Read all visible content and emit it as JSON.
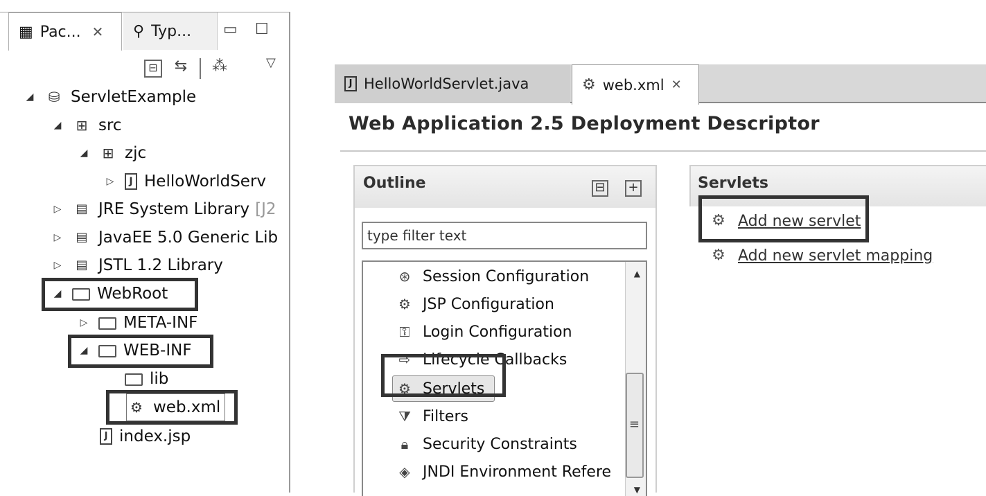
{
  "left_panel": {
    "tabs": [
      {
        "label": "Pac...",
        "close": "✕"
      },
      {
        "label": "Typ..."
      }
    ],
    "minimize": "▭",
    "maximize": "☐",
    "menu": "▽",
    "toolbar": {
      "collapse_all": "⊟",
      "link_with_editor": "⇆",
      "filters": "⁂"
    },
    "tree": {
      "project": "ServletExample",
      "src": "src",
      "package": "zjc",
      "java_file": "HelloWorldServ",
      "jre_lib": "JRE System Library",
      "jre_suffix": "[J2",
      "javaee_lib": "JavaEE 5.0 Generic Lib",
      "jstl_lib": "JSTL 1.2 Library",
      "webroot": "WebRoot",
      "meta_inf": "META-INF",
      "web_inf": "WEB-INF",
      "lib": "lib",
      "web_xml": "web.xml",
      "index_jsp": "index.jsp"
    }
  },
  "editor": {
    "tabs": [
      {
        "label": "HelloWorldServlet.java"
      },
      {
        "label": "web.xml",
        "close": "✕"
      }
    ],
    "title": "Web Application 2.5 Deployment Descriptor",
    "outline": {
      "title": "Outline",
      "collapse": "⊟",
      "expand": "+",
      "filter_placeholder": "type filter text",
      "items": [
        "Session Configuration",
        "JSP Configuration",
        "Login Configuration",
        "Lifecycle Callbacks",
        "Servlets",
        "Filters",
        "Security Constraints",
        "JNDI Environment Refere"
      ]
    },
    "servlets": {
      "title": "Servlets",
      "add_servlet": "Add new servlet",
      "add_mapping": "Add new servlet mapping"
    }
  },
  "colors": {
    "highlight_box": "#333333",
    "tab_bar": "#d8d8d8",
    "section_header": "#e8e8e8"
  }
}
